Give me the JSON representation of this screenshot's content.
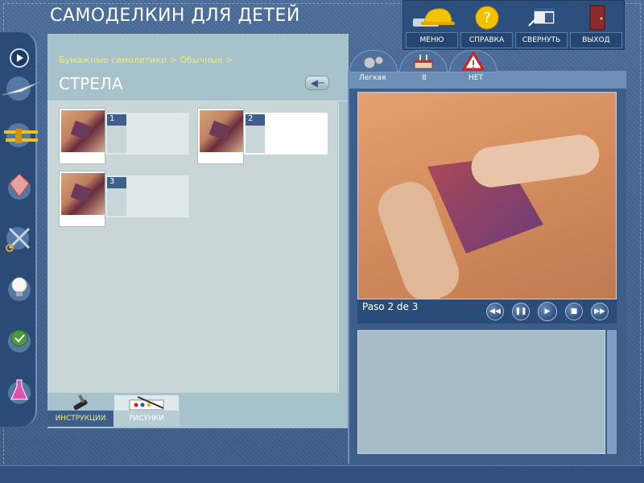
{
  "app": {
    "title": "САМОДЕЛКИН ДЛЯ ДЕТЕЙ"
  },
  "topnav": {
    "items": [
      {
        "label": "МЕНЮ",
        "icon": "hardhat-icon"
      },
      {
        "label": "СПРАВКА",
        "icon": "help-icon"
      },
      {
        "label": "СВЕРНУТЬ",
        "icon": "minimize-window-icon"
      },
      {
        "label": "ВЫХОД",
        "icon": "exit-door-icon"
      }
    ]
  },
  "sidebar": {
    "items": [
      {
        "icon": "play-arrow-icon"
      },
      {
        "icon": "paper-plane-icon"
      },
      {
        "icon": "biplane-icon"
      },
      {
        "icon": "kite-icon"
      },
      {
        "icon": "scissors-icon"
      },
      {
        "icon": "lightbulb-icon"
      },
      {
        "icon": "check-icon"
      },
      {
        "icon": "flask-icon"
      }
    ]
  },
  "left_panel": {
    "breadcrumb": "Бумажные самолетики > Обычные >",
    "title": "СТРЕЛА",
    "steps": [
      {
        "number": "1",
        "active": false
      },
      {
        "number": "2",
        "active": true
      },
      {
        "number": "3",
        "active": false
      }
    ]
  },
  "bottom_tabs": {
    "instructions": "ИНСТРУКЦИИ",
    "drawings": "РИСУНКИ"
  },
  "right_tabs": {
    "difficulty": "Легкая",
    "age": "8",
    "danger": "НЕТ"
  },
  "video": {
    "caption": "Paso 2 de 3"
  },
  "colors": {
    "accent_yellow": "#f0e880",
    "panel": "#a8c2cc",
    "navy": "#2a4c78"
  }
}
